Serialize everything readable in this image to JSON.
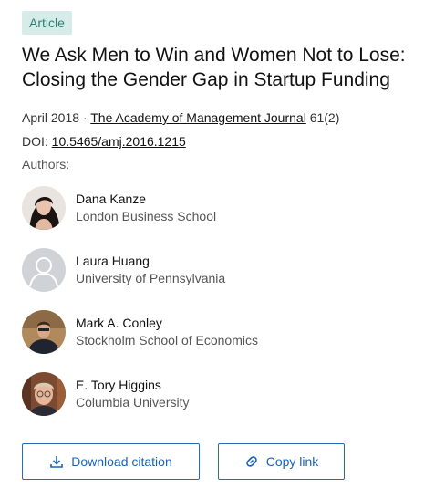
{
  "article": {
    "badge": "Article",
    "title": "We Ask Men to Win and Women Not to Lose: Closing the Gender Gap in Startup Funding",
    "date": "April 2018 · ",
    "journal": "The Academy of Management Journal",
    "issue": " 61(2)",
    "doi_label": "DOI: ",
    "doi": "10.5465/amj.2016.1215"
  },
  "authors_label": "Authors:",
  "authors": [
    {
      "name": "Dana Kanze",
      "institution": "London Business School"
    },
    {
      "name": "Laura Huang",
      "institution": "University of Pennsylvania"
    },
    {
      "name": "Mark A. Conley",
      "institution": "Stockholm School of Economics"
    },
    {
      "name": "E. Tory Higgins",
      "institution": "Columbia University"
    }
  ],
  "actions": {
    "download_label": "Download citation",
    "copy_label": "Copy link"
  },
  "colors": {
    "accent": "#1a63b8",
    "badge_bg": "#d6ece9",
    "badge_text": "#2e7d74"
  },
  "icons": {
    "download": "download-icon",
    "copy": "link-icon",
    "placeholder_avatar": "user-placeholder-icon"
  }
}
